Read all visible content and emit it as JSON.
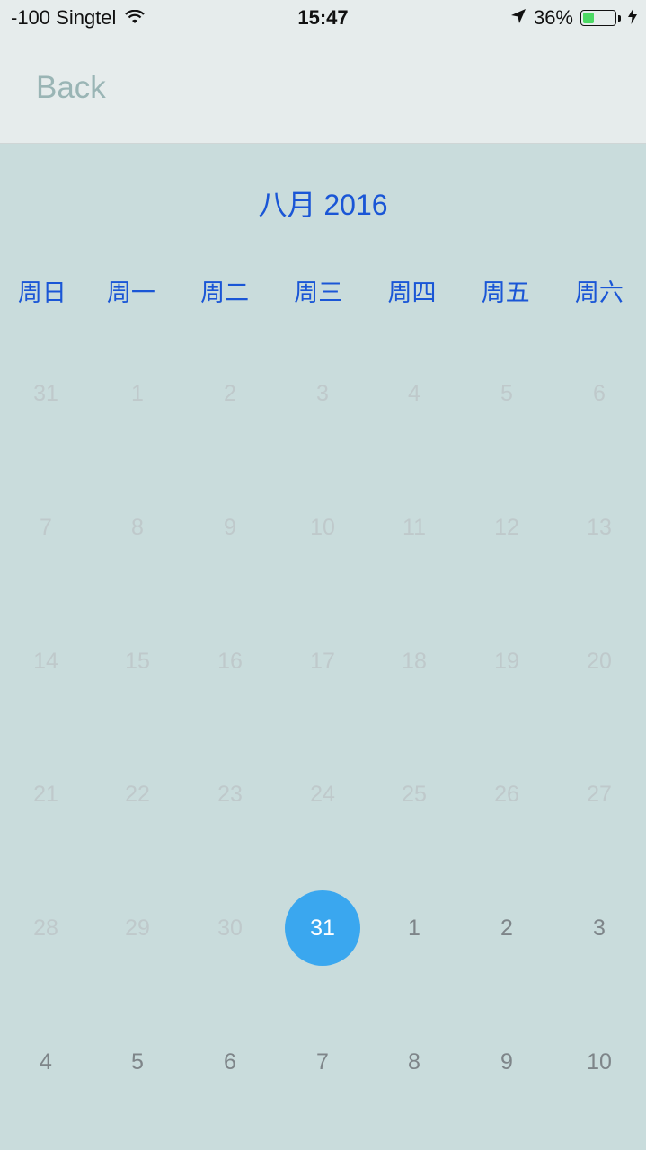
{
  "status_bar": {
    "carrier": "-100 Singtel",
    "time": "15:47",
    "battery_percent": "36%",
    "battery_level": 0.36,
    "battery_color": "#4cd964"
  },
  "nav": {
    "back_label": "Back"
  },
  "calendar": {
    "month_title": "八月 2016",
    "accent_color": "#1a56d6",
    "selected_color": "#3aa7ef",
    "weekdays": [
      "周日",
      "周一",
      "周二",
      "周三",
      "周四",
      "周五",
      "周六"
    ],
    "weeks": [
      [
        {
          "day": "31",
          "state": "muted"
        },
        {
          "day": "1",
          "state": "muted"
        },
        {
          "day": "2",
          "state": "muted"
        },
        {
          "day": "3",
          "state": "muted"
        },
        {
          "day": "4",
          "state": "muted"
        },
        {
          "day": "5",
          "state": "muted"
        },
        {
          "day": "6",
          "state": "muted"
        }
      ],
      [
        {
          "day": "7",
          "state": "muted"
        },
        {
          "day": "8",
          "state": "muted"
        },
        {
          "day": "9",
          "state": "muted"
        },
        {
          "day": "10",
          "state": "muted"
        },
        {
          "day": "11",
          "state": "muted"
        },
        {
          "day": "12",
          "state": "muted"
        },
        {
          "day": "13",
          "state": "muted"
        }
      ],
      [
        {
          "day": "14",
          "state": "muted"
        },
        {
          "day": "15",
          "state": "muted"
        },
        {
          "day": "16",
          "state": "muted"
        },
        {
          "day": "17",
          "state": "muted"
        },
        {
          "day": "18",
          "state": "muted"
        },
        {
          "day": "19",
          "state": "muted"
        },
        {
          "day": "20",
          "state": "muted"
        }
      ],
      [
        {
          "day": "21",
          "state": "muted"
        },
        {
          "day": "22",
          "state": "muted"
        },
        {
          "day": "23",
          "state": "muted"
        },
        {
          "day": "24",
          "state": "muted"
        },
        {
          "day": "25",
          "state": "muted"
        },
        {
          "day": "26",
          "state": "muted"
        },
        {
          "day": "27",
          "state": "muted"
        }
      ],
      [
        {
          "day": "28",
          "state": "muted"
        },
        {
          "day": "29",
          "state": "muted"
        },
        {
          "day": "30",
          "state": "muted"
        },
        {
          "day": "31",
          "state": "selected"
        },
        {
          "day": "1",
          "state": "active"
        },
        {
          "day": "2",
          "state": "active"
        },
        {
          "day": "3",
          "state": "active"
        }
      ],
      [
        {
          "day": "4",
          "state": "active"
        },
        {
          "day": "5",
          "state": "active"
        },
        {
          "day": "6",
          "state": "active"
        },
        {
          "day": "7",
          "state": "active"
        },
        {
          "day": "8",
          "state": "active"
        },
        {
          "day": "9",
          "state": "active"
        },
        {
          "day": "10",
          "state": "active"
        }
      ]
    ]
  }
}
